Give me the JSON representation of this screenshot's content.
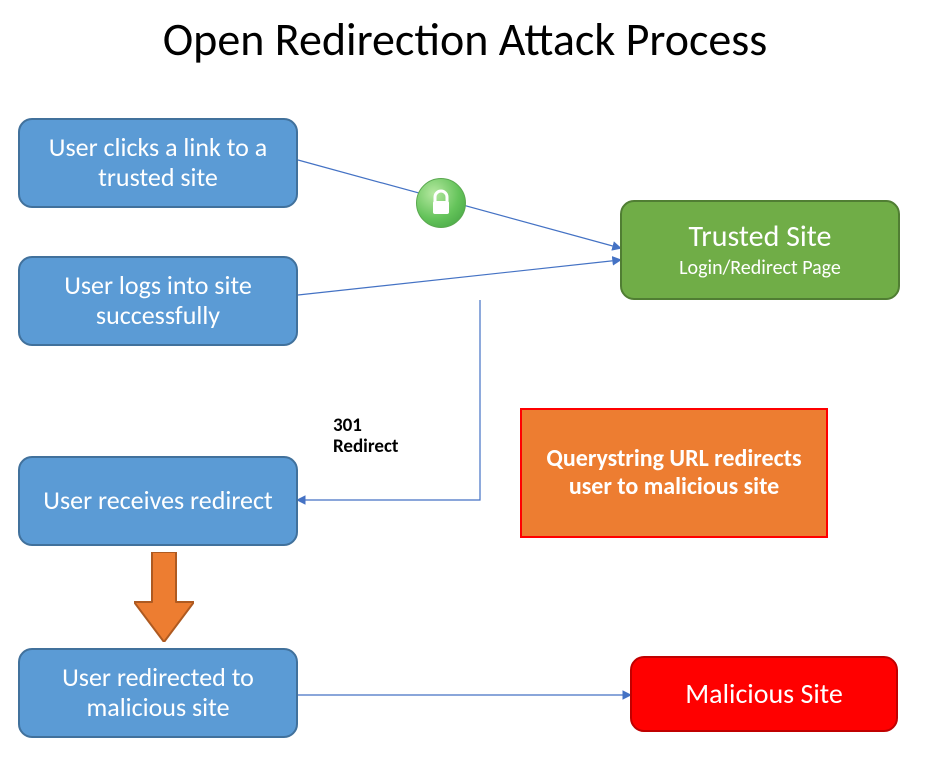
{
  "title": "Open Redirection Attack Process",
  "steps": {
    "s1": "User clicks a link to a trusted site",
    "s2": "User logs into site successfully",
    "s3": "User receives redirect",
    "s4": "User redirected to malicious site"
  },
  "trusted": {
    "title": "Trusted Site",
    "sub": "Login/Redirect Page"
  },
  "querystring": "Querystring URL redirects user to malicious site",
  "malicious": "Malicious Site",
  "redirect_label_l1": "301",
  "redirect_label_l2": "Redirect",
  "icons": {
    "lock": "lock-icon"
  },
  "colors": {
    "blue": "#5b9bd5",
    "blue_border": "#41719c",
    "green": "#70ad47",
    "orange": "#ed7d31",
    "red": "#ff0000",
    "arrow": "#4472c4",
    "down_arrow": "#ed7d31"
  }
}
